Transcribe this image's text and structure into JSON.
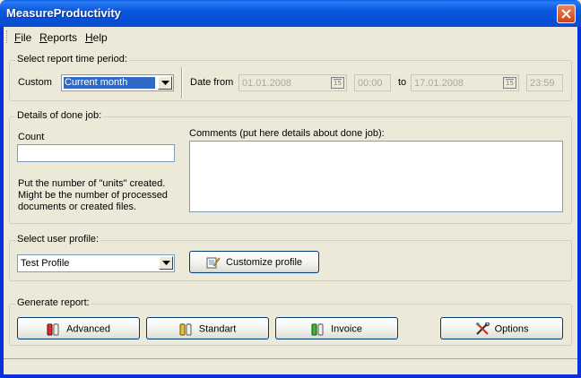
{
  "window": {
    "title": "MeasureProductivity"
  },
  "menu": [
    {
      "label": "File",
      "accel": "F",
      "rest": "ile"
    },
    {
      "label": "Reports",
      "accel": "R",
      "rest": "eports"
    },
    {
      "label": "Help",
      "accel": "H",
      "rest": "elp"
    }
  ],
  "period": {
    "group_label": "Select report time period:",
    "mode_label": "Custom",
    "mode_value": "Current month",
    "date_from_label": "Date from",
    "date_from": "01.01.2008",
    "time_from": "00:00",
    "to_label": "to",
    "date_to": "17.01.2008",
    "time_to": "23:59",
    "calendar_icon_text": "15"
  },
  "details": {
    "group_label": "Details of done job:",
    "count_label": "Count",
    "count_value": "",
    "hint_line1": "Put the number of \"units\" created.",
    "hint_line2": "Might be the number of processed",
    "hint_line3": "documents or created files.",
    "comments_label": "Comments (put here details about done job):",
    "comments_value": ""
  },
  "profile": {
    "group_label": "Select user profile:",
    "selected": "Test Profile",
    "customize_label": "Customize profile"
  },
  "report": {
    "group_label": "Generate report:",
    "advanced_label": "Advanced",
    "standart_label": "Standart",
    "invoice_label": "Invoice",
    "options_label": "Options"
  },
  "icons": {
    "close": "close-icon",
    "dropdown": "chevron-down-icon",
    "calendar": "calendar-icon",
    "customize": "edit-notepad-icon",
    "advanced": "battery-red-icon",
    "standart": "battery-yellow-icon",
    "invoice": "battery-green-icon",
    "options": "tools-icon"
  }
}
